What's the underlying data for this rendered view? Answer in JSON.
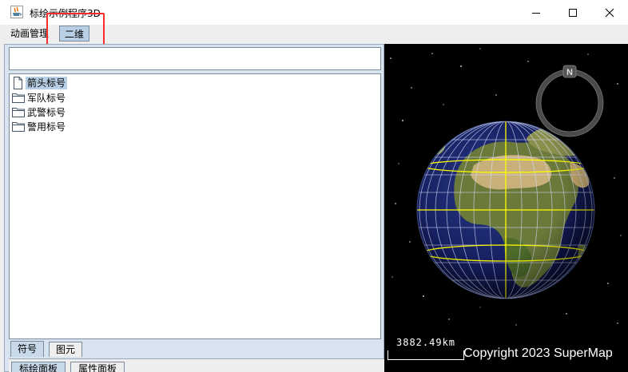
{
  "window": {
    "title": "标绘示例程序3D",
    "icon": "java-cup-icon",
    "controls": {
      "minimize": "minimize-icon",
      "maximize": "maximize-icon",
      "close": "close-icon"
    }
  },
  "menubar": {
    "items": [
      {
        "label": "动画管理"
      },
      {
        "label": "二维",
        "highlighted": true
      }
    ]
  },
  "left_panel": {
    "search": {
      "value": "",
      "placeholder": ""
    },
    "tree": {
      "items": [
        {
          "label": "箭头标号",
          "icon": "file-icon",
          "selected": true
        },
        {
          "label": "军队标号",
          "icon": "folder-icon"
        },
        {
          "label": "武警标号",
          "icon": "folder-icon"
        },
        {
          "label": "警用标号",
          "icon": "folder-icon"
        }
      ]
    },
    "subtabs": [
      {
        "label": "符号",
        "active": true
      },
      {
        "label": "图元"
      }
    ],
    "main_tabs": [
      {
        "label": "标绘面板",
        "active": true
      },
      {
        "label": "属性面板"
      }
    ]
  },
  "globe": {
    "compass_label": "N",
    "scale_text": "3882.49km",
    "copyright": "Copyright 2023 SuperMap",
    "grid_color": "#ffff00"
  },
  "colors": {
    "selection": "#b8cfe5",
    "highlight_box": "#ff2b2b",
    "tab_active": "#c8d9ea"
  }
}
